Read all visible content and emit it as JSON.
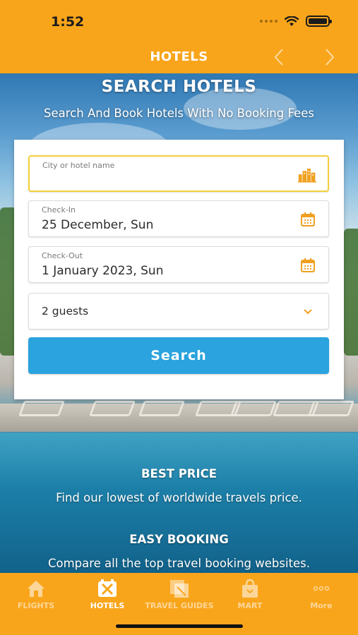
{
  "status": {
    "time": "1:52"
  },
  "nav": {
    "title": "HOTELS"
  },
  "hero": {
    "title": "SEARCH HOTELS",
    "subtitle": "Search And Book Hotels With No Booking Fees"
  },
  "form": {
    "city_placeholder": "City or hotel name",
    "checkin_label": "Check-In",
    "checkin_value": "25 December, Sun",
    "checkout_label": "Check-Out",
    "checkout_value": "1 January 2023, Sun",
    "guests_value": "2 guests",
    "search_label": "Search"
  },
  "features": [
    {
      "title": "BEST PRICE",
      "text": "Find our lowest of worldwide travels price."
    },
    {
      "title": "EASY BOOKING",
      "text": "Compare all the top travel booking websites."
    }
  ],
  "tabs": [
    {
      "label": "FLIGHTS",
      "icon": "home-icon"
    },
    {
      "label": "HOTELS",
      "icon": "hotel-icon",
      "active": true
    },
    {
      "label": "TRAVEL GUIDES",
      "icon": "guide-icon"
    },
    {
      "label": "MART",
      "icon": "shopping-bag-icon"
    },
    {
      "label": "More",
      "icon": "more-icon"
    }
  ],
  "colors": {
    "brand": "#f9a51b",
    "accent": "#2aa3de",
    "field_focus": "#f2cf3a"
  }
}
